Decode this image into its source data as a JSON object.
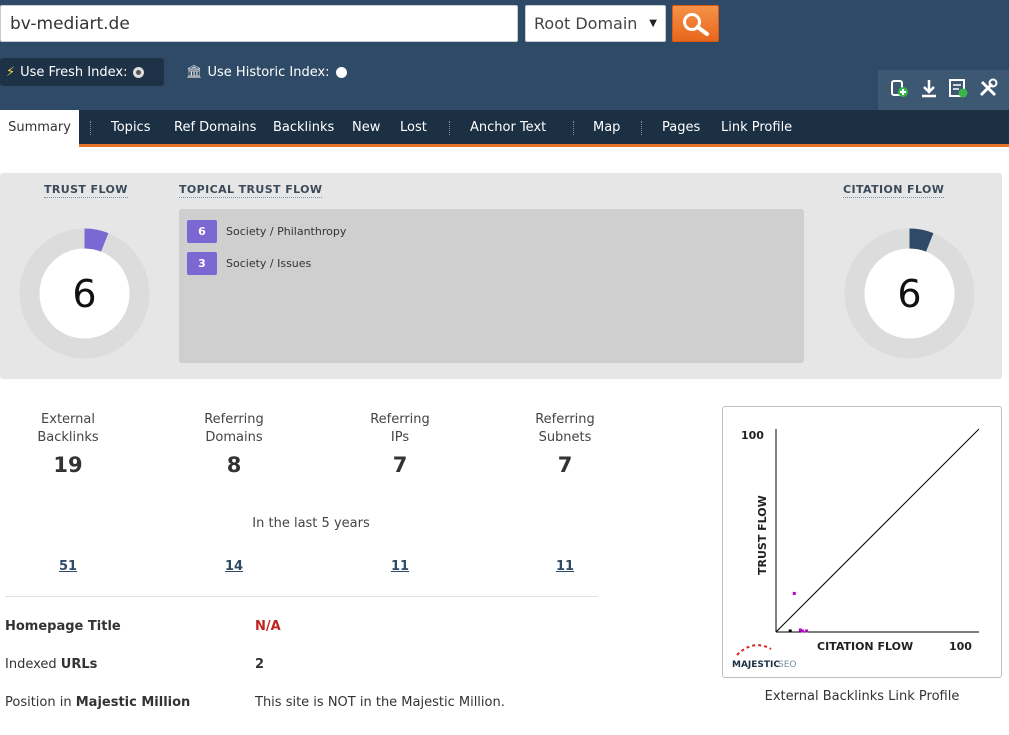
{
  "search": {
    "domain_value": "bv-mediart.de",
    "scope_selected": "Root Domain"
  },
  "index": {
    "fresh_label": "Use Fresh Index:",
    "historic_label": "Use Historic Index:",
    "selected": "fresh"
  },
  "tools": [
    "add-bucket-icon",
    "download-icon",
    "report-icon",
    "tools-icon"
  ],
  "nav": {
    "items": [
      "Summary",
      "Topics",
      "Ref Domains",
      "Backlinks",
      "New",
      "Lost",
      "Anchor Text",
      "Map",
      "Pages",
      "Link Profile"
    ],
    "active": "Summary"
  },
  "flow": {
    "trust_flow_title": "TRUST FLOW",
    "trust_flow_value": "6",
    "citation_flow_title": "CITATION FLOW",
    "citation_flow_value": "6",
    "topical_title": "TOPICAL TRUST FLOW",
    "topics": [
      {
        "score": "6",
        "label": "Society / Philanthropy"
      },
      {
        "score": "3",
        "label": "Society / Issues"
      }
    ]
  },
  "stats": [
    {
      "label_1": "External",
      "label_2": "Backlinks",
      "value": "19",
      "historic": "51"
    },
    {
      "label_1": "Referring",
      "label_2": "Domains",
      "value": "8",
      "historic": "14"
    },
    {
      "label_1": "Referring",
      "label_2": "IPs",
      "value": "7",
      "historic": "11"
    },
    {
      "label_1": "Referring",
      "label_2": "Subnets",
      "value": "7",
      "historic": "11"
    }
  ],
  "last_5_years": "In the last 5 years",
  "info": {
    "homepage_title_label_a": "Homepage Title",
    "homepage_title_value": "N/A",
    "indexed_label_a": "Indexed ",
    "indexed_label_b": "URLs",
    "indexed_value": "2",
    "position_label_a": "Position in ",
    "position_label_b": "Majestic Million",
    "position_value": "This site is NOT in the Majestic Million."
  },
  "colors": {
    "header_bg": "#2e4a66",
    "nav_bg": "#1c3044",
    "accent_orange": "#e8742a",
    "trust_flow": "#7c68d3",
    "citation_flow": "#2e4a66",
    "na_red": "#c0241e"
  },
  "plot": {
    "x_label": "CITATION FLOW",
    "y_label": "TRUST FLOW",
    "x_max_label": "100",
    "y_max_label": "100",
    "brand_a": "MAJESTIC",
    "brand_b": "SEO",
    "caption": "External Backlinks Link Profile"
  },
  "chart_data": {
    "type": "scatter",
    "title": "",
    "xlabel": "CITATION FLOW",
    "ylabel": "TRUST FLOW",
    "xlim": [
      0,
      100
    ],
    "ylim": [
      0,
      100
    ],
    "diagonal": true,
    "points": [
      {
        "x": 9,
        "y": 19,
        "color": "#b400c8"
      },
      {
        "x": 12,
        "y": 1,
        "color": "#b400c8"
      },
      {
        "x": 13,
        "y": 0.5,
        "color": "#b400c8"
      },
      {
        "x": 15,
        "y": 0.5,
        "color": "#b400c8"
      },
      {
        "x": 7,
        "y": 0.5,
        "color": "#000000"
      }
    ]
  }
}
